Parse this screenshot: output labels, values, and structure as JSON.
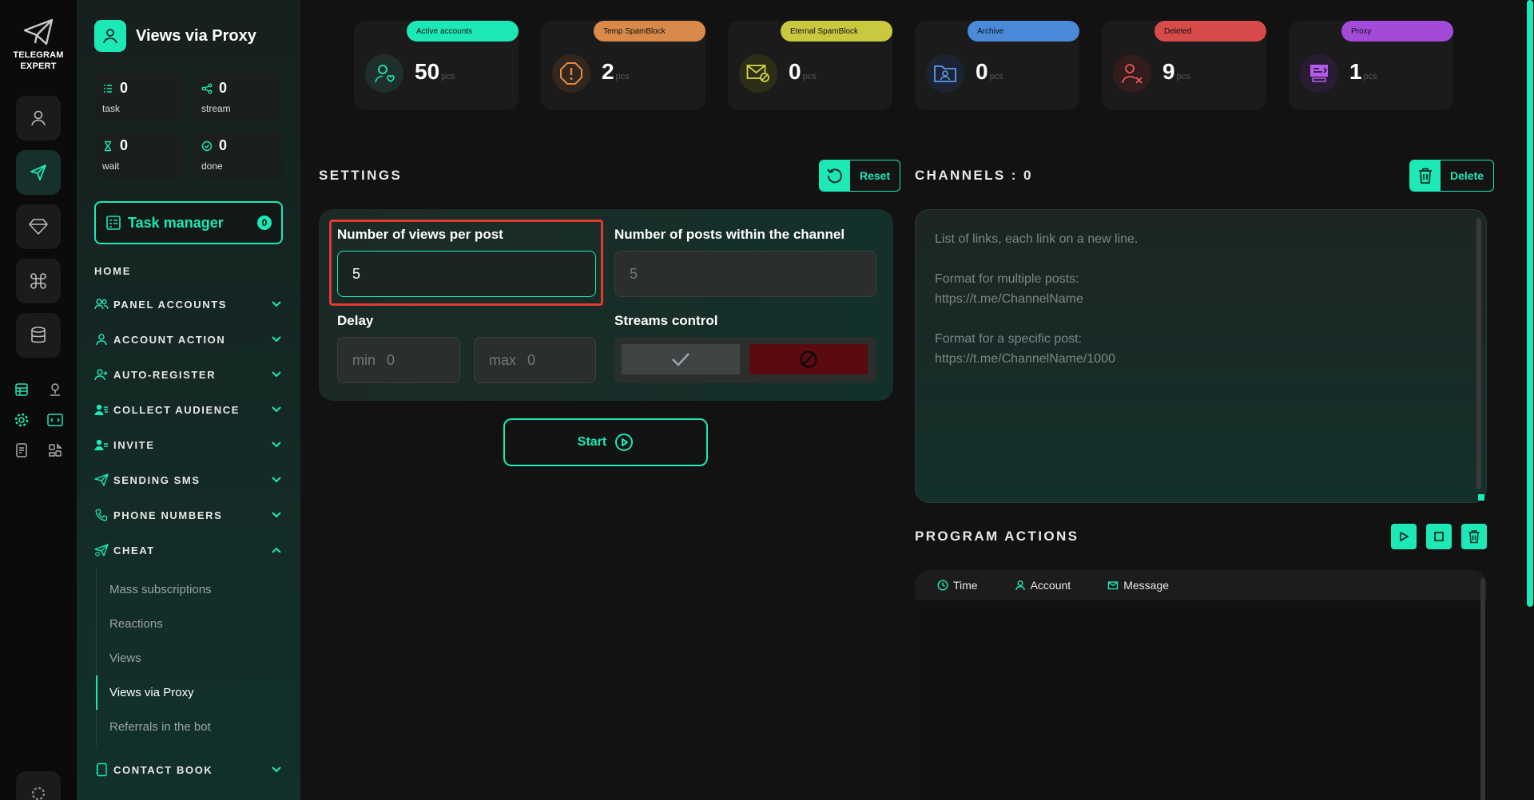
{
  "brand": {
    "line1": "TELEGRAM",
    "line2": "EXPERT"
  },
  "colors": {
    "accent": "#1de9b6",
    "danger": "#e03a2f"
  },
  "rail": {
    "buttons": [
      "user-icon",
      "send-icon",
      "diamond-icon",
      "command-icon",
      "database-icon"
    ],
    "small_icons": [
      "table-icon",
      "location-user-icon",
      "gear-icon",
      "code-icon",
      "document-icon",
      "modules-icon"
    ]
  },
  "sidebar": {
    "title": "Views via Proxy",
    "stats": [
      {
        "value": "0",
        "label": "task",
        "icon": "list-icon"
      },
      {
        "value": "0",
        "label": "stream",
        "icon": "share-icon"
      },
      {
        "value": "0",
        "label": "wait",
        "icon": "hourglass-icon"
      },
      {
        "value": "0",
        "label": "done",
        "icon": "check-circle-icon"
      }
    ],
    "task_manager": {
      "label": "Task manager",
      "count": "0"
    },
    "home": "HOME",
    "nav": [
      {
        "label": "PANEL ACCOUNTS",
        "icon": "users-icon",
        "expanded": false
      },
      {
        "label": "ACCOUNT ACTION",
        "icon": "user-icon",
        "expanded": false
      },
      {
        "label": "AUTO-REGISTER",
        "icon": "user-plus-icon",
        "expanded": false
      },
      {
        "label": "COLLECT AUDIENCE",
        "icon": "audience-icon",
        "expanded": false
      },
      {
        "label": "INVITE",
        "icon": "invite-icon",
        "expanded": false
      },
      {
        "label": "SENDING SMS",
        "icon": "send-icon",
        "expanded": false
      },
      {
        "label": "PHONE NUMBERS",
        "icon": "phone-icon",
        "expanded": false
      },
      {
        "label": "CHEAT",
        "icon": "cheat-icon",
        "expanded": true
      }
    ],
    "cheat_items": [
      "Mass subscriptions",
      "Reactions",
      "Views",
      "Views via Proxy",
      "Referrals in the bot"
    ],
    "cheat_active": "Views via Proxy",
    "contact_book": "CONTACT BOOK"
  },
  "cards": [
    {
      "tag": "Active accounts",
      "value": "50",
      "unit": "pcs",
      "color": "#1de9b6",
      "icon": "user-heart-icon"
    },
    {
      "tag": "Temp SpamBlock",
      "value": "2",
      "unit": "pcs",
      "color": "#d98a4a",
      "icon": "warning-octagon-icon"
    },
    {
      "tag": "Eternal SpamBlock",
      "value": "0",
      "unit": "pcs",
      "color": "#c9c940",
      "icon": "mail-block-icon"
    },
    {
      "tag": "Archive",
      "value": "0",
      "unit": "pcs",
      "color": "#4a8ad9",
      "icon": "folder-user-icon"
    },
    {
      "tag": "Deleted",
      "value": "9",
      "unit": "pcs",
      "color": "#d94a4a",
      "icon": "user-x-icon"
    },
    {
      "tag": "Proxy",
      "value": "1",
      "unit": "pcs",
      "color": "#a44ad9",
      "icon": "proxy-icon"
    }
  ],
  "settings": {
    "title": "SETTINGS",
    "reset": "Reset",
    "views_label": "Number of views per post",
    "views_value": "5",
    "posts_label": "Number of posts within the channel",
    "posts_placeholder": "5",
    "delay_label": "Delay",
    "delay_min": {
      "label": "min",
      "value": "0"
    },
    "delay_max": {
      "label": "max",
      "value": "0"
    },
    "streams_label": "Streams control",
    "start": "Start"
  },
  "channels": {
    "title": "CHANNELS : 0",
    "delete": "Delete",
    "placeholder_lines": [
      "List of links, each link on a new line.",
      "",
      "Format for multiple posts:",
      "https://t.me/ChannelName",
      "",
      "Format for a specific post:",
      "https://t.me/ChannelName/1000"
    ]
  },
  "actions": {
    "title": "PROGRAM ACTIONS",
    "columns": [
      {
        "label": "Time",
        "icon": "clock-icon"
      },
      {
        "label": "Account",
        "icon": "user-icon"
      },
      {
        "label": "Message",
        "icon": "mail-icon"
      }
    ]
  }
}
